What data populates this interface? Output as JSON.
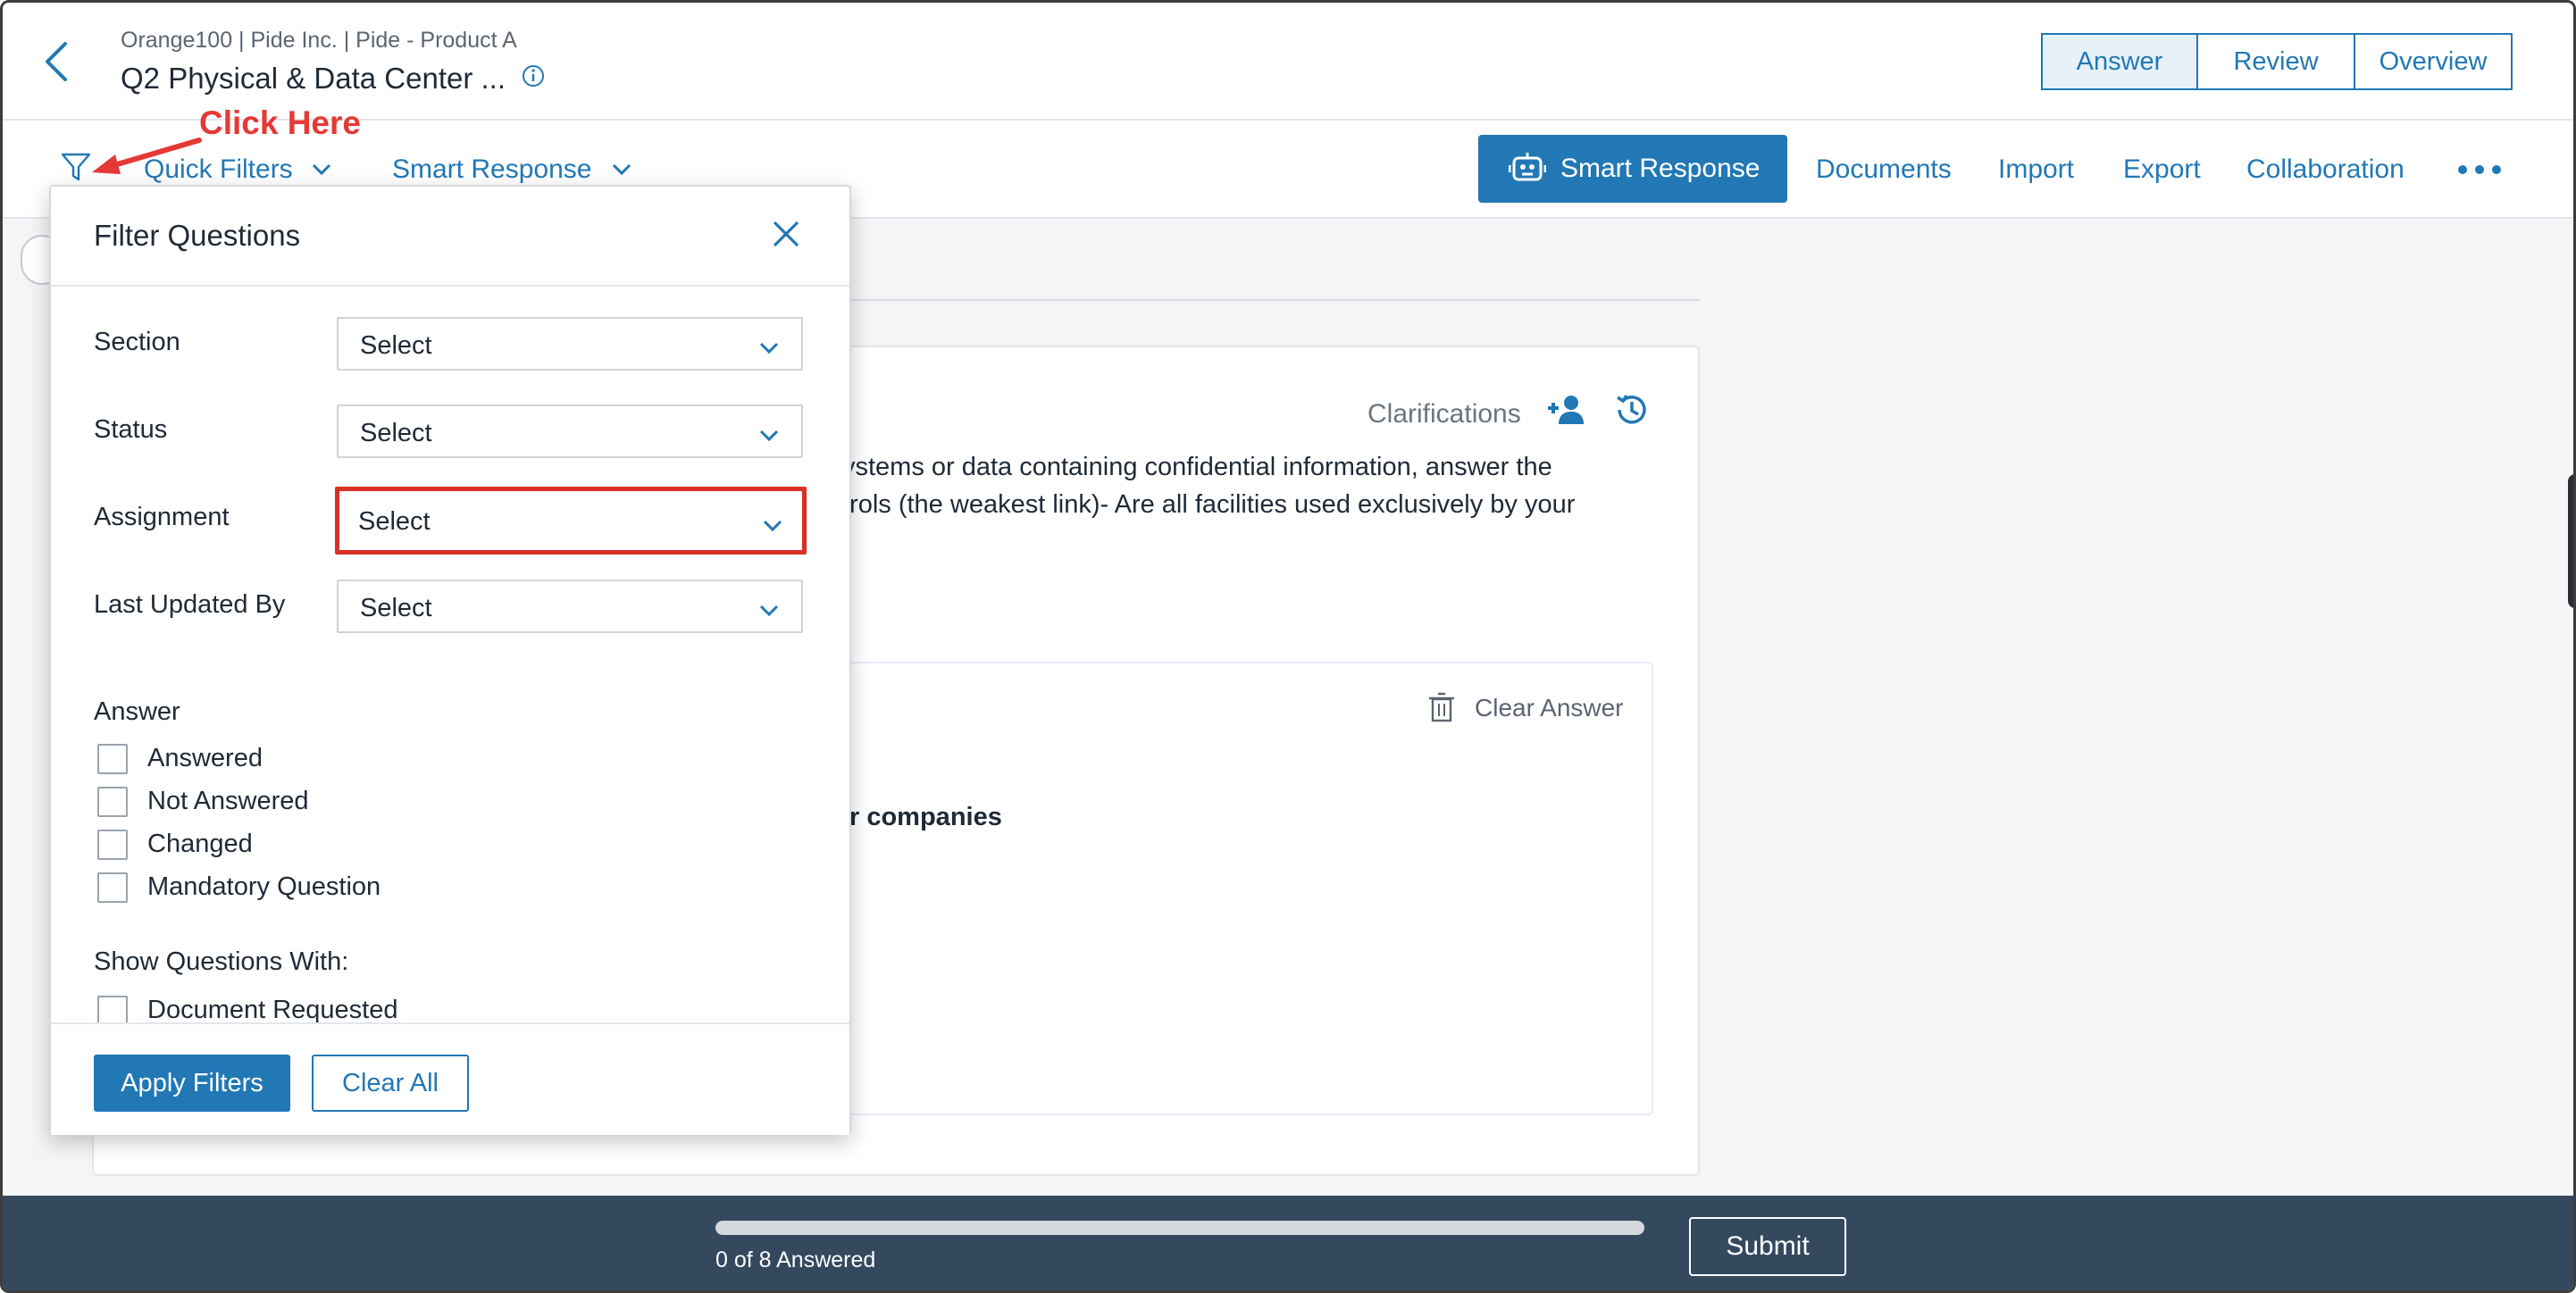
{
  "header": {
    "breadcrumb": "Orange100 | Pide Inc. | Pide - Product A",
    "title": "Q2 Physical & Data Center ...",
    "tabs": [
      "Answer",
      "Review",
      "Overview"
    ],
    "active_tab": "Answer"
  },
  "toolbar": {
    "quick_filters": "Quick Filters",
    "smart_response_menu": "Smart Response",
    "smart_response_button": "Smart Response",
    "links": [
      "Documents",
      "Import",
      "Export",
      "Collaboration"
    ]
  },
  "question_card": {
    "clarifications": "Clarifications",
    "line1": "ystems or data containing confidential information, answer the",
    "line2": "trols (the weakest link)- Are all facilities used exclusively by your",
    "clear_answer": "Clear Answer",
    "option_fragment": "r companies"
  },
  "filter_popup": {
    "title": "Filter Questions",
    "fields": [
      {
        "label": "Section",
        "value": "Select"
      },
      {
        "label": "Status",
        "value": "Select"
      },
      {
        "label": "Assignment",
        "value": "Select"
      },
      {
        "label": "Last Updated By",
        "value": "Select"
      }
    ],
    "answer_label": "Answer",
    "answer_options": [
      "Answered",
      "Not Answered",
      "Changed",
      "Mandatory Question"
    ],
    "show_with_label": "Show Questions With:",
    "show_with_options": [
      "Document Requested"
    ],
    "apply_label": "Apply Filters",
    "clear_label": "Clear All"
  },
  "footer": {
    "progress_text": "0 of 8 Answered",
    "progress_fraction": 0,
    "submit_label": "Submit"
  },
  "annotation": {
    "text": "Click Here",
    "color": "#e53935"
  },
  "colors": {
    "accent": "#2178b5",
    "footer_bg": "#34495e",
    "highlight": "#d93025"
  }
}
